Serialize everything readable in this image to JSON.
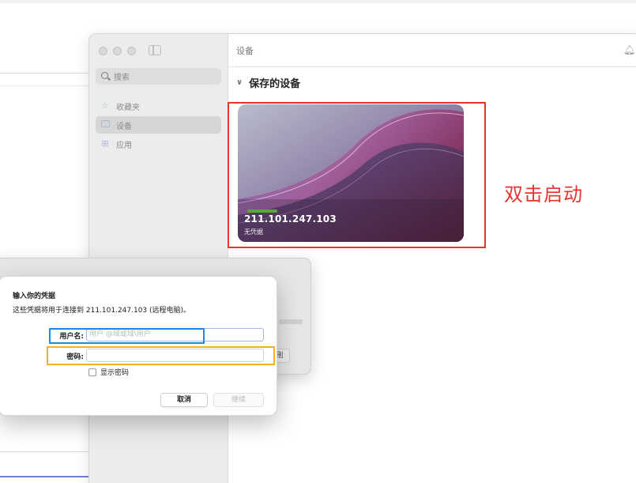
{
  "window": {
    "search_placeholder": "搜索",
    "content_title": "设备",
    "sidebar": {
      "items": [
        {
          "label": "收藏夹",
          "icon": "star-icon"
        },
        {
          "label": "设备",
          "icon": "monitor-icon",
          "active": true
        },
        {
          "label": "应用",
          "icon": "grid-icon"
        }
      ]
    },
    "section_title": "保存的设备",
    "device": {
      "ip": "211.101.247.103",
      "subtitle": "无凭据"
    }
  },
  "annotation": {
    "double_click_text": "双击启动",
    "color": "#e8322c"
  },
  "background_dialog": {
    "button_fragment": "刪"
  },
  "dialog": {
    "title": "输入你的凭据",
    "description": "这些凭据将用于连接到 211.101.247.103 (远程电脑)。",
    "username_label": "用户名:",
    "username_placeholder": "用户 @域或域\\用户",
    "password_label": "密码:",
    "show_password_label": "显示密码",
    "cancel_label": "取消",
    "continue_label": "继续"
  },
  "colors": {
    "blue_highlight": "#1e88e5",
    "yellow_highlight": "#f5b024",
    "red_highlight": "#e8322c"
  }
}
